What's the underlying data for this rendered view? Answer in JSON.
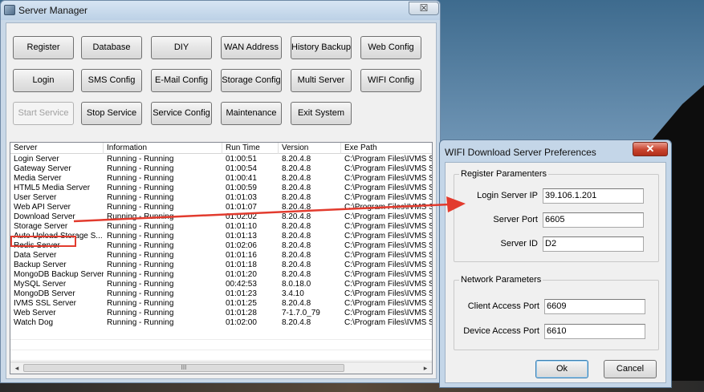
{
  "window": {
    "title": "Server Manager",
    "close_glyph": "☒"
  },
  "buttons": {
    "register": "Register",
    "database": "Database",
    "diy": "DIY",
    "wan_address": "WAN Address",
    "history_backup": "History Backup",
    "web_config": "Web Config",
    "login": "Login",
    "sms_config": "SMS Config",
    "email_config": "E-Mail Config",
    "storage_config": "Storage Config",
    "multi_server": "Multi Server",
    "wifi_config": "WIFI Config",
    "start_service": "Start Service",
    "stop_service": "Stop Service",
    "service_config": "Service Config",
    "maintenance": "Maintenance",
    "exit_system": "Exit System"
  },
  "table": {
    "columns": [
      "Server",
      "Information",
      "Run Time",
      "Version",
      "Exe Path"
    ],
    "rows": [
      [
        "Login Server",
        "Running - Running",
        "01:00:51",
        "8.20.4.8",
        "C:\\Program Files\\IVMS Se"
      ],
      [
        "Gateway Server",
        "Running - Running",
        "01:00:54",
        "8.20.4.8",
        "C:\\Program Files\\IVMS Se"
      ],
      [
        "Media Server",
        "Running - Running",
        "01:00:41",
        "8.20.4.8",
        "C:\\Program Files\\IVMS Se"
      ],
      [
        "HTML5 Media Server",
        "Running - Running",
        "01:00:59",
        "8.20.4.8",
        "C:\\Program Files\\IVMS Se"
      ],
      [
        "User Server",
        "Running - Running",
        "01:01:03",
        "8.20.4.8",
        "C:\\Program Files\\IVMS Se"
      ],
      [
        "Web API Server",
        "Running - Running",
        "01:01:07",
        "8.20.4.8",
        "C:\\Program Files\\IVMS Se"
      ],
      [
        "Download Server",
        "Running - Running",
        "01:02:02",
        "8.20.4.8",
        "C:\\Program Files\\IVMS Se"
      ],
      [
        "Storage Server",
        "Running - Running",
        "01:01:10",
        "8.20.4.8",
        "C:\\Program Files\\IVMS Se"
      ],
      [
        "Auto Upload Storage S...",
        "Running - Running",
        "01:01:13",
        "8.20.4.8",
        "C:\\Program Files\\IVMS Se"
      ],
      [
        "Redis Server",
        "Running - Running",
        "01:02:06",
        "8.20.4.8",
        "C:\\Program Files\\IVMS Se"
      ],
      [
        "Data Server",
        "Running - Running",
        "01:01:16",
        "8.20.4.8",
        "C:\\Program Files\\IVMS Se"
      ],
      [
        "Backup Server",
        "Running - Running",
        "01:01:18",
        "8.20.4.8",
        "C:\\Program Files\\IVMS Se"
      ],
      [
        "MongoDB Backup Server",
        "Running - Running",
        "01:01:20",
        "8.20.4.8",
        "C:\\Program Files\\IVMS Se"
      ],
      [
        "MySQL Server",
        "Running - Running",
        "00:42:53",
        "8.0.18.0",
        "C:\\Program Files\\IVMS Se"
      ],
      [
        "MongoDB Server",
        "Running - Running",
        "01:01:23",
        "3.4.10",
        "C:\\Program Files\\IVMS Se"
      ],
      [
        "IVMS SSL Server",
        "Running - Running",
        "01:01:25",
        "8.20.4.8",
        "C:\\Program Files\\IVMS Se"
      ],
      [
        "Web Server",
        "Running - Running",
        "01:01:28",
        "7-1.7.0_79",
        "C:\\Program Files\\IVMS Se"
      ],
      [
        "Watch Dog",
        "Running - Running",
        "01:02:00",
        "8.20.4.8",
        "C:\\Program Files\\IVMS Se"
      ]
    ],
    "highlighted_row": "Download Server",
    "scroll_left": "◂",
    "scroll_mid": "III",
    "scroll_right": "▸"
  },
  "dialog": {
    "title": "WIFI Download Server Preferences",
    "close_glyph": "✕",
    "register_group": "Register Paramenters",
    "login_ip_label": "Login Server IP",
    "login_ip_value": "39.106.1.201",
    "server_port_label": "Server Port",
    "server_port_value": "6605",
    "server_id_label": "Server ID",
    "server_id_value": "D2",
    "network_group": "Network Parameters",
    "client_port_label": "Client Access Port",
    "client_port_value": "6609",
    "device_port_label": "Device Access Port",
    "device_port_value": "6610",
    "ok_label": "Ok",
    "cancel_label": "Cancel"
  },
  "colors": {
    "annotation": "#e23b2e",
    "dialog_frame": "#c4d6e8",
    "window_frame": "#c9d8e7"
  }
}
